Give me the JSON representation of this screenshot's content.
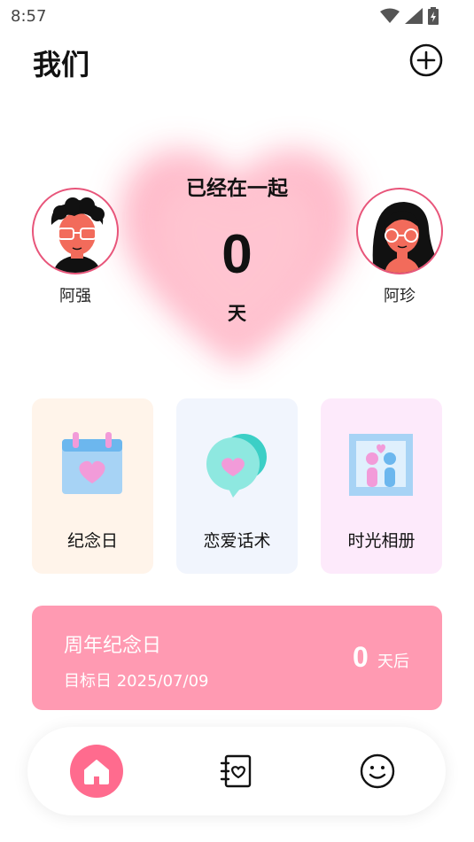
{
  "status_bar": {
    "time": "8:57",
    "icons": [
      "wifi-icon",
      "cellular-signal-icon",
      "battery-charging-icon"
    ]
  },
  "header": {
    "title": "我们",
    "add_icon": "plus-circle-icon"
  },
  "couple": {
    "together_label": "已经在一起",
    "days": "0",
    "days_unit": "天",
    "left_person": {
      "name": "阿强",
      "avatar": "boy-avatar-icon"
    },
    "right_person": {
      "name": "阿珍",
      "avatar": "girl-avatar-icon"
    }
  },
  "features": [
    {
      "label": "纪念日",
      "icon": "calendar-heart-icon"
    },
    {
      "label": "恋爱话术",
      "icon": "chat-bubble-heart-icon"
    },
    {
      "label": "时光相册",
      "icon": "photo-album-icon"
    }
  ],
  "anniversary": {
    "title": "周年纪念日",
    "date_label": "目标日 2025/07/09",
    "count": "0",
    "unit": "天后"
  },
  "bottom_nav": [
    {
      "icon": "home-icon",
      "active": true
    },
    {
      "icon": "notebook-heart-icon",
      "active": false
    },
    {
      "icon": "smiley-icon",
      "active": false
    }
  ],
  "colors": {
    "accent_pink": "#ff6b8e",
    "banner_pink": "#ff9ab2",
    "avatar_border": "#e8557a",
    "card_anniv_bg": "#fff4ea",
    "card_talk_bg": "#f1f5fd",
    "card_album_bg": "#fdeafb"
  }
}
